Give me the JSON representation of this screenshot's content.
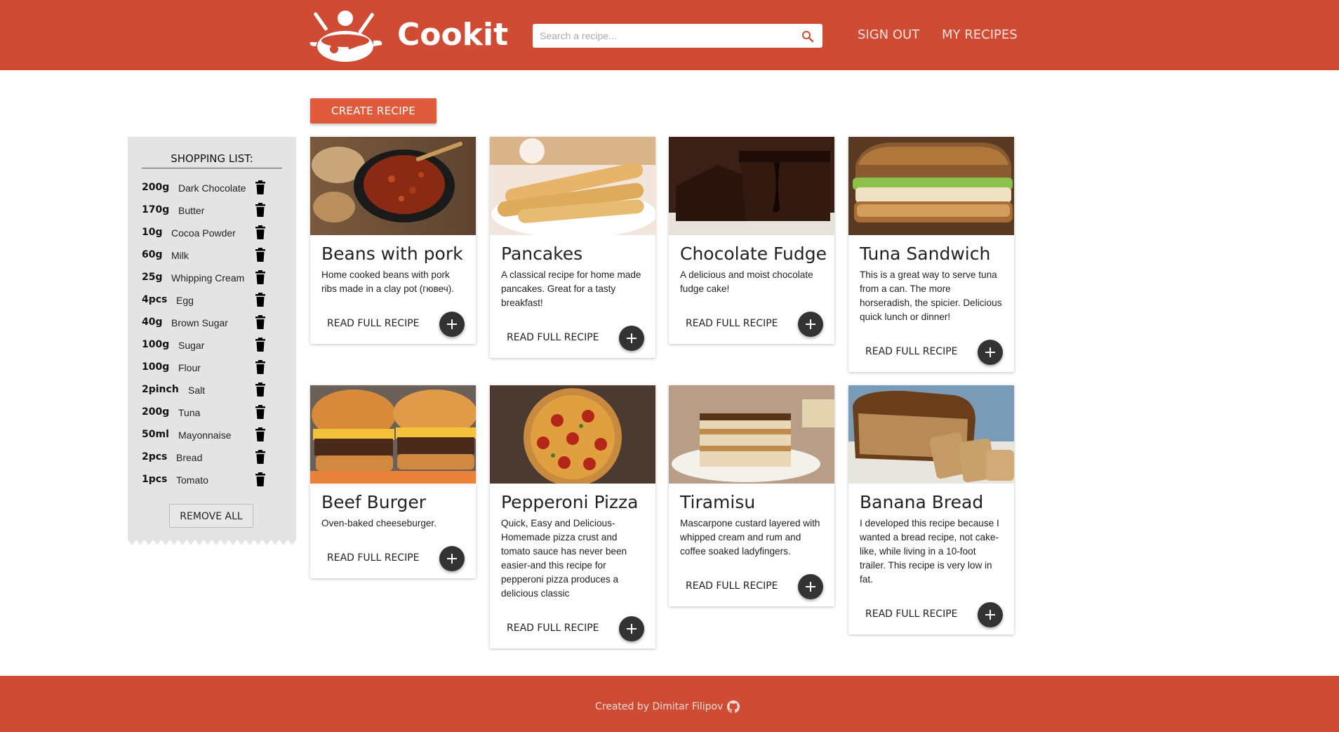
{
  "header": {
    "brand": "Cookit",
    "search_placeholder": "Search a recipe...",
    "nav": {
      "sign_out": "SIGN OUT",
      "my_recipes": "MY RECIPES"
    }
  },
  "create_button": "CREATE RECIPE",
  "shopping_list": {
    "title": "SHOPPING LIST:",
    "items": [
      {
        "qty": "200g",
        "name": "Dark Chocolate"
      },
      {
        "qty": "170g",
        "name": "Butter"
      },
      {
        "qty": "10g",
        "name": "Cocoa Powder"
      },
      {
        "qty": "60g",
        "name": "Milk"
      },
      {
        "qty": "25g",
        "name": "Whipping Cream"
      },
      {
        "qty": "4pcs",
        "name": "Egg"
      },
      {
        "qty": "40g",
        "name": "Brown Sugar"
      },
      {
        "qty": "100g",
        "name": "Sugar"
      },
      {
        "qty": "100g",
        "name": "Flour"
      },
      {
        "qty": "2pinch",
        "name": "Salt"
      },
      {
        "qty": "200g",
        "name": "Tuna"
      },
      {
        "qty": "50ml",
        "name": "Mayonnaise"
      },
      {
        "qty": "2pcs",
        "name": "Bread"
      },
      {
        "qty": "1pcs",
        "name": "Tomato"
      }
    ],
    "remove_all": "REMOVE ALL"
  },
  "read_full_label": "READ FULL RECIPE",
  "recipes": [
    {
      "title": "Beans with pork",
      "description": "Home cooked beans with pork ribs made in a clay pot (гювеч).",
      "image": "beans-pot"
    },
    {
      "title": "Pancakes",
      "description": "A classical recipe for home made pancakes. Great for a tasty breakfast!",
      "image": "pancakes"
    },
    {
      "title": "Chocolate Fudge",
      "description": "A delicious and moist chocolate fudge cake!",
      "image": "chocolate-cake"
    },
    {
      "title": "Tuna Sandwich",
      "description": "This is a great way to serve tuna from a can. The more horseradish, the spicier. Delicious quick lunch or dinner!",
      "image": "sandwich"
    },
    {
      "title": "Beef Burger",
      "description": "Oven-baked cheeseburger.",
      "image": "burger"
    },
    {
      "title": "Pepperoni Pizza",
      "description": "Quick, Easy and Delicious- Homemade pizza crust and tomato sauce has never been easier-and this recipe for pepperoni pizza produces a delicious classic",
      "image": "pizza"
    },
    {
      "title": "Tiramisu",
      "description": "Mascarpone custard layered with whipped cream and rum and coffee soaked ladyfingers.",
      "image": "tiramisu"
    },
    {
      "title": "Banana Bread",
      "description": "I developed this recipe because I wanted a bread recipe, not cake-like, while living in a 10-foot trailer. This recipe is very low in fat.",
      "image": "banana-bread"
    }
  ],
  "footer": {
    "text": "Created by Dimitar Filipov"
  },
  "colors": {
    "brand": "#d04b33",
    "accent": "#e05a3c",
    "fab": "#333333"
  }
}
